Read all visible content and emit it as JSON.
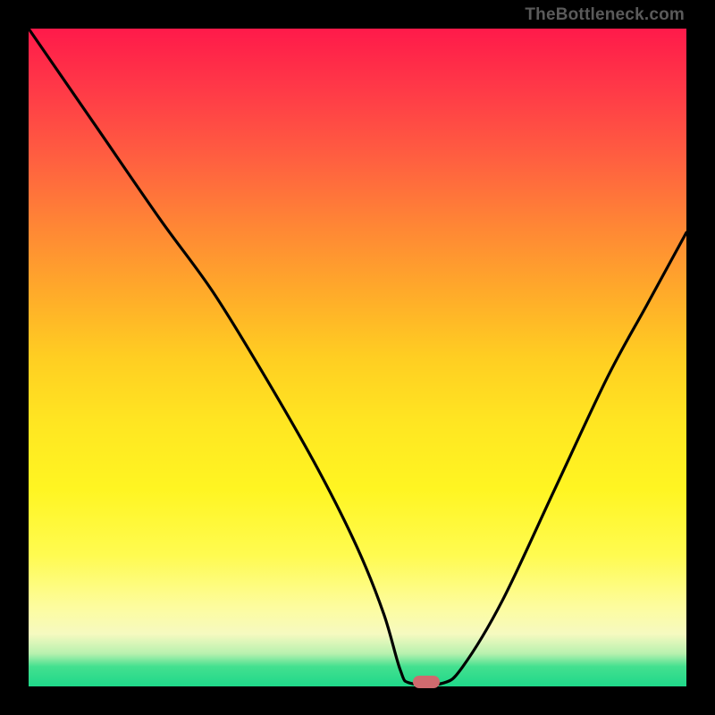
{
  "watermark": "TheBottleneck.com",
  "marker": {
    "cx_pct": 60.5,
    "cy_pct": 99.3
  },
  "chart_data": {
    "type": "line",
    "title": "",
    "xlabel": "",
    "ylabel": "",
    "xlim": [
      0,
      100
    ],
    "ylim": [
      0,
      100
    ],
    "series": [
      {
        "name": "bottleneck-curve",
        "x": [
          0,
          10,
          20,
          28,
          36,
          44,
          50,
          54,
          56.5,
          58,
          63,
          66,
          72,
          80,
          88,
          94,
          100
        ],
        "values": [
          100,
          85.5,
          71,
          60,
          47,
          33,
          21,
          11,
          2.5,
          0.5,
          0.5,
          3,
          13,
          30,
          47,
          58,
          69
        ]
      }
    ],
    "marker": {
      "x": 60.5,
      "y": 0.7
    },
    "colors": {
      "curve": "#000000",
      "marker": "#cf6a6e",
      "gradient_top": "#ff1a4a",
      "gradient_mid": "#ffe622",
      "gradient_bottom": "#1fd88a"
    }
  }
}
